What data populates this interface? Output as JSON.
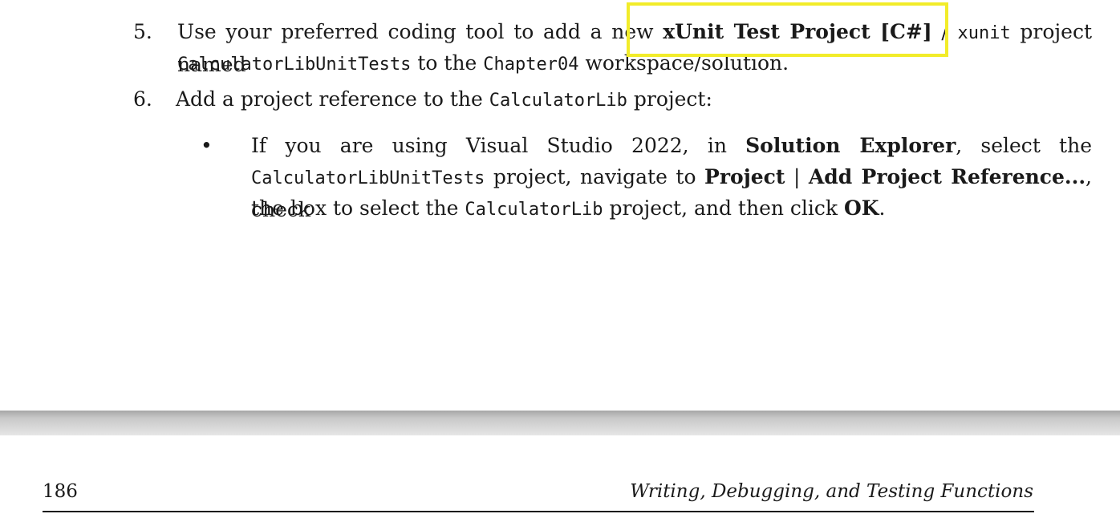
{
  "steps": {
    "step5": {
      "number": "5.",
      "text_a": "Use your preferred coding tool to add a new ",
      "bold_a": "xUnit Test Project [C#]",
      "text_b": " / ",
      "code_a": "xunit",
      "text_c": " project named",
      "code_b": "CalculatorLibUnitTests",
      "text_d": " to the ",
      "code_c": "Chapter04",
      "text_e": " workspace/solution."
    },
    "step6": {
      "number": "6.",
      "text_a": "Add a project reference to the ",
      "code_a": "CalculatorLib",
      "text_b": " project:"
    }
  },
  "bullet": {
    "marker": "•",
    "line1_text_a": "If you are using Visual Studio 2022, in ",
    "line1_bold": "Solution Explorer",
    "line1_text_b": ", select the",
    "line2_code": "CalculatorLibUnitTests",
    "line2_text_a": " project, navigate to ",
    "line2_bold_a": "Project",
    "line2_text_b": " | ",
    "line2_bold_b": "Add Project Reference...",
    "line2_text_c": ", check",
    "line3_text_a": "the box to select the ",
    "line3_code": "CalculatorLib",
    "line3_text_b": " project, and then click ",
    "line3_bold": "OK",
    "line3_text_c": "."
  },
  "highlight": {
    "color": "#f2ec2a"
  },
  "footer": {
    "page_number": "186",
    "chapter_title": "Writing, Debugging, and Testing Functions"
  }
}
